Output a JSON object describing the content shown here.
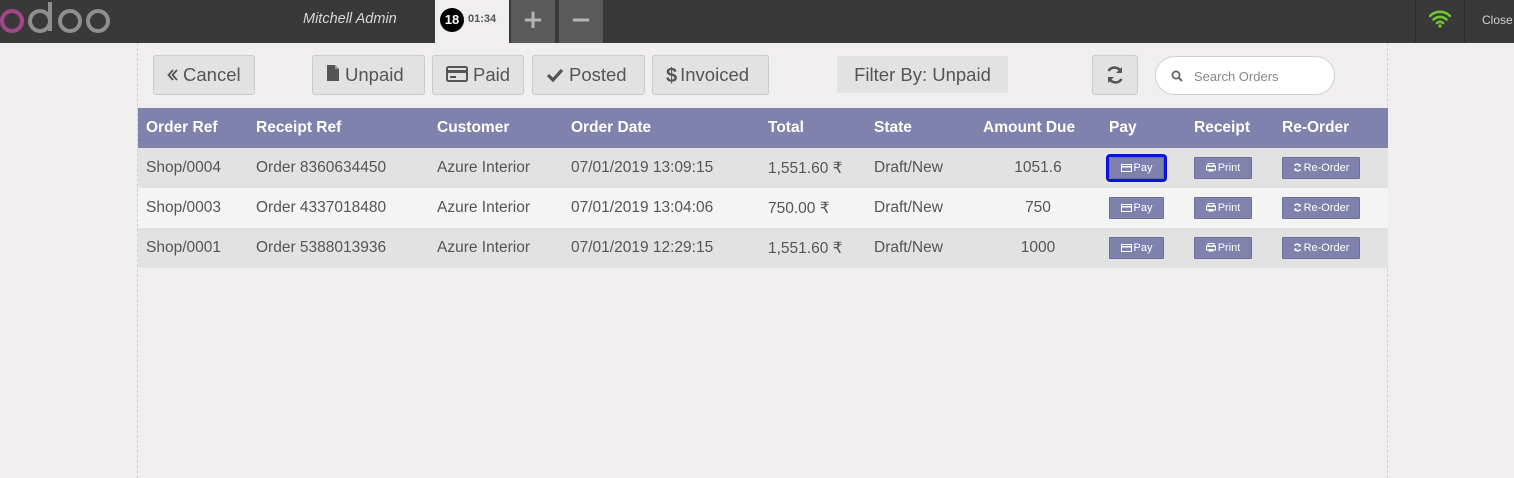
{
  "topbar": {
    "username": "Mitchell Admin",
    "order_number": "18",
    "order_time": "01:34",
    "add_tab": "+",
    "remove_tab": "−",
    "close_label": "Close"
  },
  "toolbar": {
    "cancel_label": "Cancel",
    "unpaid_label": "Unpaid",
    "paid_label": "Paid",
    "posted_label": "Posted",
    "invoiced_label": "Invoiced",
    "filter_label": "Filter By: Unpaid",
    "search_placeholder": "Search Orders"
  },
  "table": {
    "headers": [
      "Order Ref",
      "Receipt Ref",
      "Customer",
      "Order Date",
      "Total",
      "State",
      "Amount Due",
      "Pay",
      "Receipt",
      "Re-Order"
    ],
    "rows": [
      {
        "order_ref": "Shop/0004",
        "receipt_ref": "Order 8360634450",
        "customer": "Azure Interior",
        "order_date": "07/01/2019 13:09:15",
        "total": "1,551.60 ₹",
        "state": "Draft/New",
        "amount_due": "1051.6",
        "pay": "Pay",
        "receipt": "Print",
        "reorder": "Re-Order"
      },
      {
        "order_ref": "Shop/0003",
        "receipt_ref": "Order 4337018480",
        "customer": "Azure Interior",
        "order_date": "07/01/2019 13:04:06",
        "total": "750.00 ₹",
        "state": "Draft/New",
        "amount_due": "750",
        "pay": "Pay",
        "receipt": "Print",
        "reorder": "Re-Order"
      },
      {
        "order_ref": "Shop/0001",
        "receipt_ref": "Order 5388013936",
        "customer": "Azure Interior",
        "order_date": "07/01/2019 12:29:15",
        "total": "1,551.60 ₹",
        "state": "Draft/New",
        "amount_due": "1000",
        "pay": "Pay",
        "receipt": "Print",
        "reorder": "Re-Order"
      }
    ]
  },
  "colors": {
    "topbar": "#393939",
    "header": "#7f82ac",
    "focus_outline": "#0a14d8",
    "wifi": "#6ec82e",
    "logo_accent": "#a24689"
  },
  "icons": [
    "odoo-logo",
    "wifi-icon",
    "double-chevron-left-icon",
    "file-icon",
    "credit-card-icon",
    "check-icon",
    "dollar-icon",
    "refresh-icon",
    "search-icon",
    "print-icon"
  ]
}
